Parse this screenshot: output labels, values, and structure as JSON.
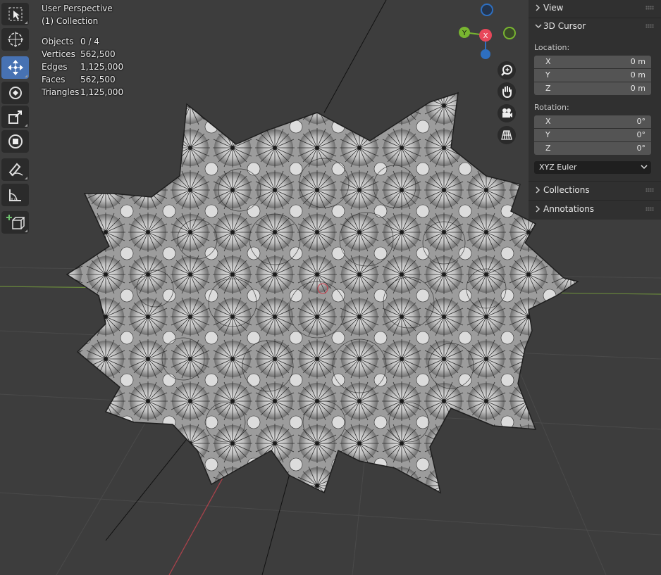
{
  "viewport": {
    "view_name": "User Perspective",
    "collection_name": "(1) Collection",
    "stats": [
      {
        "label": "Objects",
        "value": "0 / 4"
      },
      {
        "label": "Vertices",
        "value": "562,500"
      },
      {
        "label": "Edges",
        "value": "1,125,000"
      },
      {
        "label": "Faces",
        "value": "562,500"
      },
      {
        "label": "Triangles",
        "value": "1,125,000"
      }
    ]
  },
  "toolbar": {
    "tools": [
      {
        "name": "select-box-tool",
        "icon": "select-box-icon",
        "active": false
      },
      {
        "name": "cursor-tool",
        "icon": "cursor-icon",
        "active": false
      },
      {
        "name": "move-tool",
        "icon": "move-icon",
        "active": true
      },
      {
        "name": "rotate-tool",
        "icon": "rotate-icon",
        "active": false
      },
      {
        "name": "scale-tool",
        "icon": "scale-icon",
        "active": false
      },
      {
        "name": "transform-tool",
        "icon": "transform-icon",
        "active": false
      },
      {
        "name": "annotate-tool",
        "icon": "annotate-icon",
        "active": false
      },
      {
        "name": "measure-tool",
        "icon": "measure-icon",
        "active": false
      },
      {
        "name": "add-cube-tool",
        "icon": "add-cube-icon",
        "active": false
      }
    ]
  },
  "gizmo": {
    "x_label": "X",
    "y_label": "Y",
    "colors": {
      "x": "#e8475a",
      "y": "#78b530",
      "z": "#2e6fc0"
    }
  },
  "nav_buttons": [
    "zoom-icon",
    "pan-hand-icon",
    "camera-icon",
    "ortho-grid-icon"
  ],
  "sidebar": {
    "view_header": "View",
    "cursor_header": "3D Cursor",
    "location_label": "Location:",
    "location": [
      {
        "axis": "X",
        "value": "0 m"
      },
      {
        "axis": "Y",
        "value": "0 m"
      },
      {
        "axis": "Z",
        "value": "0 m"
      }
    ],
    "rotation_label": "Rotation:",
    "rotation": [
      {
        "axis": "X",
        "value": "0°"
      },
      {
        "axis": "Y",
        "value": "0°"
      },
      {
        "axis": "Z",
        "value": "0°"
      }
    ],
    "rotation_mode": "XYZ Euler",
    "collections_header": "Collections",
    "annotations_header": "Annotations"
  },
  "colors": {
    "background": "#3d3d3d",
    "mesh": "#a8a8a8",
    "active_tool": "#4772b3",
    "x_axis_line": "#a8424b",
    "y_axis_line": "#6a8a3c"
  }
}
